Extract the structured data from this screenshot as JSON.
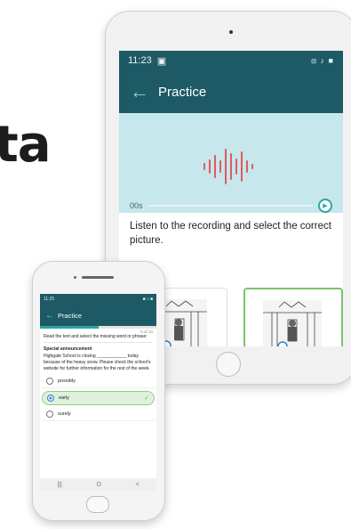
{
  "background_word": "ta",
  "tablet": {
    "status": {
      "time": "11:23",
      "icons": "⦻ ♪ ■"
    },
    "header": {
      "title": "Practice"
    },
    "audio": {
      "elapsed": "00s"
    },
    "instruction": "Listen to the recording and select the correct picture."
  },
  "phone": {
    "status": {
      "time": "11:25",
      "icons": "■ ♪ ■"
    },
    "header": {
      "title": "Practice"
    },
    "progress": {
      "counter": "5 of 10",
      "fraction": 0.5
    },
    "question": "Read the text and select the missing word or phrase:",
    "announcement_title": "Special announcement",
    "passage": "Highgate School is closing ____________ today because of the heavy snow. Please check the school's website for further information for the rest of the week.",
    "options": [
      {
        "label": "possibly",
        "selected": false
      },
      {
        "label": "early",
        "selected": true
      },
      {
        "label": "surely",
        "selected": false
      }
    ],
    "nav": {
      "recent": "|||",
      "home": "O",
      "back": "<"
    }
  },
  "colors": {
    "teal_dark": "#1d5a66",
    "accent": "#2aa7a1",
    "audio_bg": "#c6e7ec",
    "wave": "#e05a62",
    "selected_green": "#8fcf83"
  }
}
